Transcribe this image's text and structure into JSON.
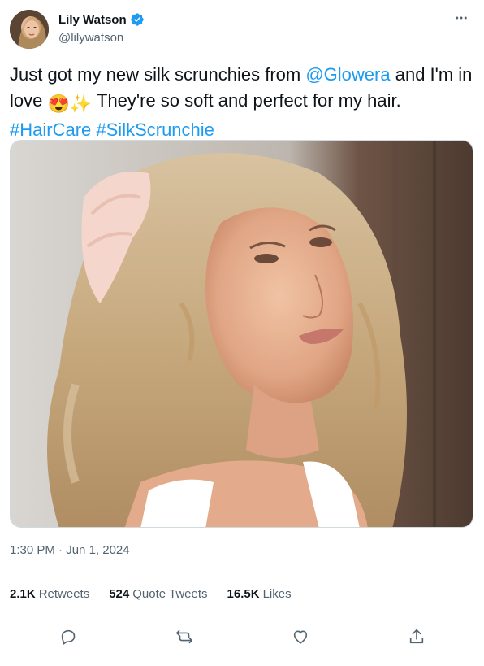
{
  "author": {
    "name": "Lily Watson",
    "handle": "@lilywatson",
    "verified": true,
    "avatar_icon": "profile-photo"
  },
  "tweet": {
    "text_part1": "Just got my new silk scrunchies from ",
    "mention": "@Glowera",
    "text_part2": " and I'm in love ",
    "emoji1": "😍",
    "emoji2": "✨",
    "text_part3": " They're so soft and perfect for my hair. ",
    "hashtag1": "#HairCare",
    "hashtag2": "#SilkScrunchie"
  },
  "media": {
    "icon": "photo-woman-silk-scrunchie"
  },
  "meta": {
    "time": "1:30 PM",
    "separator": " · ",
    "date": "Jun 1, 2024"
  },
  "stats": {
    "retweets_count": "2.1K",
    "retweets_label": "Retweets",
    "quotes_count": "524",
    "quotes_label": "Quote Tweets",
    "likes_count": "16.5K",
    "likes_label": "Likes"
  },
  "actions": [
    "reply-icon",
    "retweet-icon",
    "like-icon",
    "share-icon"
  ],
  "colors": {
    "accent": "#1d9bf0",
    "text": "#0f1419",
    "secondary": "#536471",
    "divider": "#eff3f4"
  }
}
